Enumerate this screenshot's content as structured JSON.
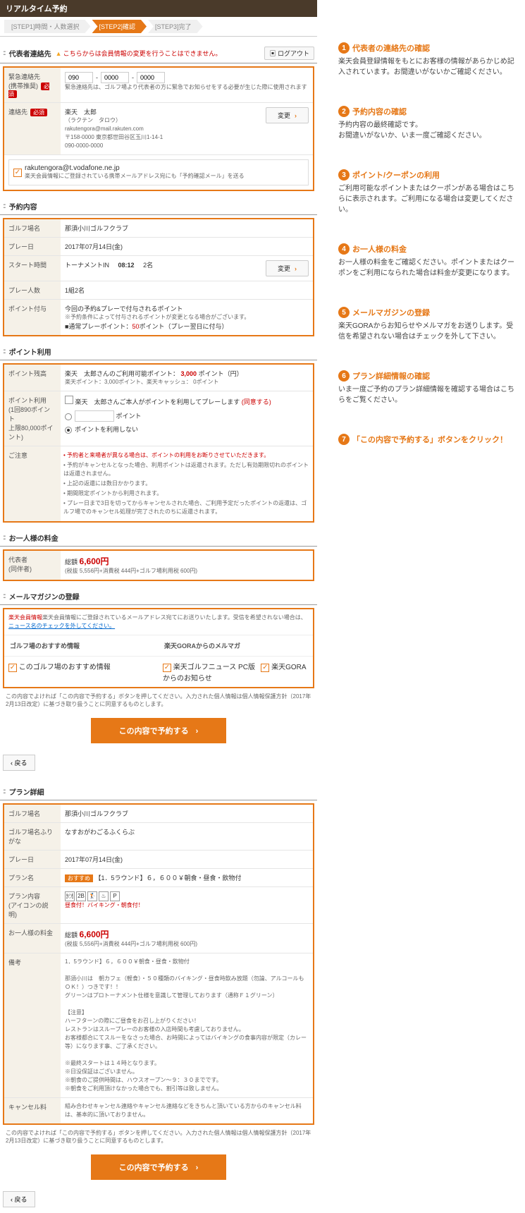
{
  "title": "リアルタイム予約",
  "steps": [
    "[STEP1]時間・人数選択",
    "[STEP2]確認",
    "[STEP3]完了"
  ],
  "logout": "ログアウト",
  "sec1": {
    "title": "代表者連絡先",
    "warn": "こちらからは会員情報の変更を行うことはできません。",
    "emg_label": "緊急連絡先\n(携帯推奨)",
    "req": "必須",
    "emg_vals": [
      "090",
      "0000",
      "0000"
    ],
    "emg_note": "緊急連絡先は、ゴルフ場より代表者の方に緊急でお知らせをする必要が生じた際に使用されます",
    "contact_label": "連絡先",
    "name": "楽天　太郎",
    "kana": "（ラクテン　タロウ）",
    "email": "rakutengora@mail.rakuten.com",
    "addr": "〒158-0000 東京都世田谷区玉川1-14-1",
    "tel": "090-0000-0000",
    "change": "変更",
    "ck_email": "rakutengora@t.vodafone.ne.jp",
    "ck_note": "楽天会員情報にご登録されている携帯メールアドレス宛にも「予約確認メール」を送る"
  },
  "sec2": {
    "title": "予約内容",
    "course_l": "ゴルフ場名",
    "course_v": "那須小川ゴルフクラブ",
    "date_l": "プレー日",
    "date_v": "2017年07月14日(金)",
    "start_l": "スタート時間",
    "start_v1": "トーナメントIN",
    "start_v2": "08:12",
    "start_v3": "2名",
    "pl_l": "プレー人数",
    "pl_v": "1組2名",
    "pt_l": "ポイント付与",
    "pt_line1": "今回の予約&プレーで付与されるポイント",
    "pt_line2": "※予約条件によって付与されるポイントが変更となる場合がございます。",
    "pt_line3a": "■通常プレーポイント：",
    "pt_line3b": "50",
    "pt_line3c": "ポイント（プレー翌日に付与）",
    "change": "変更"
  },
  "sec3": {
    "title": "ポイント利用",
    "bal_l": "ポイント残高",
    "bal_name": "楽天　太郎さんのご利用可能ポイント：",
    "bal_pt": "3,000",
    "bal_unit": "ポイント（円）",
    "bal_sub": "楽天ポイント：3,000ポイント、楽天キャッシュ： 0ポイント",
    "use_l": "ポイント利用\n(1回890ポイント\n上限80,000ポイント)",
    "use_ck": "楽天　太郎さんご本人がポイントを利用してプレーします",
    "use_agree": "(同意する)",
    "opt1": "ポイント",
    "opt2": "ポイントを利用しない",
    "note_l": "ご注意",
    "notes": [
      "予約者と来場者が異なる場合は、ポイントの利用をお断りさせていただきます。",
      "予約がキャンセルとなった場合、利用ポイントは返還されます。ただし有効期限切れのポイントは返還されません。",
      "上記の返還には数日かかります。",
      "期間限定ポイントから利用されます。",
      "プレー日まで3日を切ってからキャンセルされた場合、ご利用予定だったポイントの返還は、ゴルフ場でのキャンセル処理が完了されたのちに返還されます。"
    ]
  },
  "sec4": {
    "title": "お一人様の料金",
    "rep_l": "代表者\n(同伴者)",
    "total": "総額 ",
    "price": "6,600円",
    "breakdown": "(税抜 5,556円+消費税 444円+ゴルフ場利用税 600円)"
  },
  "sec5": {
    "title": "メールマガジンの登録",
    "intro_a": "楽天会員情報にご登録されているメールアドレス宛てにお送りいたします。受信を希望されない場合は、",
    "intro_b": "ニュース名のチェックを外してください。",
    "col1_h": "ゴルフ場のおすすめ情報",
    "col2_h": "楽天GORAからのメルマガ",
    "items": [
      "このゴルフ場のおすすめ情報",
      "楽天ゴルフニュース PC版",
      "楽天GORAからのお知らせ"
    ]
  },
  "agree": "この内容でよければ「この内容で予約する」ボタンを押してください。入力された個人情報は個人情報保護方針（2017年2月13日改定）に基づき取り扱うことに同意するものとします。",
  "submit": "この内容で予約する",
  "back": "戻る",
  "sec6": {
    "title": "プラン詳細",
    "course_l": "ゴルフ場名",
    "course_v": "那須小川ゴルフクラブ",
    "furi_l": "ゴルフ場名ふりがな",
    "furi_v": "なすおがわごるふくらぶ",
    "date_l": "プレー日",
    "date_v": "2017年07月14日(金)",
    "plan_l": "プラン名",
    "plan_tag": "おすすめ",
    "plan_v": "【1．5ラウンド】６，６００￥朝食・昼食・飲物付",
    "pc_l": "プラン内容\n(アイコンの説明)",
    "pc_note": "昼食付！バイキング・朝食付！",
    "price_l": "お一人様の料金",
    "price_t": "総額 ",
    "price_v": "6,600円",
    "price_b": "(税抜 5,556円+消費税 444円+ゴルフ場利用税 600円)",
    "remark_l": "備考",
    "remarks": [
      "1．5ラウンド】６，６００￥朝食・昼食・飲物付",
      "",
      "那須小川は　朝カフェ（軽食）・５０種類のバイキング・昼食時飲み放題（勿論、アルコールもＯＫ！）つきです！！",
      "グリーンはプロトーナメント仕様を意識して管理しております（通称Ｆ１グリーン）",
      "",
      "【注意】",
      "ハーフターンの際にご昼食をお召し上がりください！",
      "レストランはスループレーのお客様の入店時間も考慮しておりません。",
      "お客様都合にてスルーをなさった場合、お時間によってはバイキングの食事内容が限定（カレー等）になります事、ご了承ください。",
      "",
      "※最終スタートは１４時となります。",
      "※日没保証はございません。",
      "※朝食のご提供時間は、ハウスオープン～９：３０までです。",
      "※朝食をご利用頂けなかった場合でも、割引等は致しません。"
    ],
    "cxl_l": "キャンセル料",
    "cxl_v": "組み合わせキャンセル連絡やキャンセル連絡などをきちんと頂いている方からのキャンセル料は、基本的に頂いておりません。"
  },
  "annots": [
    {
      "n": "1",
      "t": "代表者の連絡先の確認",
      "b": "楽天会員登録情報をもとにお客様の情報があらかじめ記入されています。お間違いがないかご確認ください。"
    },
    {
      "n": "2",
      "t": "予約内容の確認",
      "b": "予約内容の最終確認です。\nお間違いがないか、いま一度ご確認ください。"
    },
    {
      "n": "3",
      "t": "ポイント/クーポンの利用",
      "b": "ご利用可能なポイントまたはクーポンがある場合はこちらに表示されます。ご利用になる場合は変更してください。"
    },
    {
      "n": "4",
      "t": "お一人様の料金",
      "b": "お一人様の料金をご確認ください。ポイントまたはクーポンをご利用になられた場合は料金が変更になります。"
    },
    {
      "n": "5",
      "t": "メールマガジンの登録",
      "b": "楽天GORAからお知らせやメルマガをお送りします。受信を希望されない場合はチェックを外して下さい。"
    },
    {
      "n": "6",
      "t": "プラン詳細情報の確認",
      "b": "いま一度ご予約のプラン詳細情報を確認する場合はこちらをご覧ください。"
    },
    {
      "n": "7",
      "t": "「この内容で予約する」ボタンをクリック！",
      "b": ""
    }
  ]
}
